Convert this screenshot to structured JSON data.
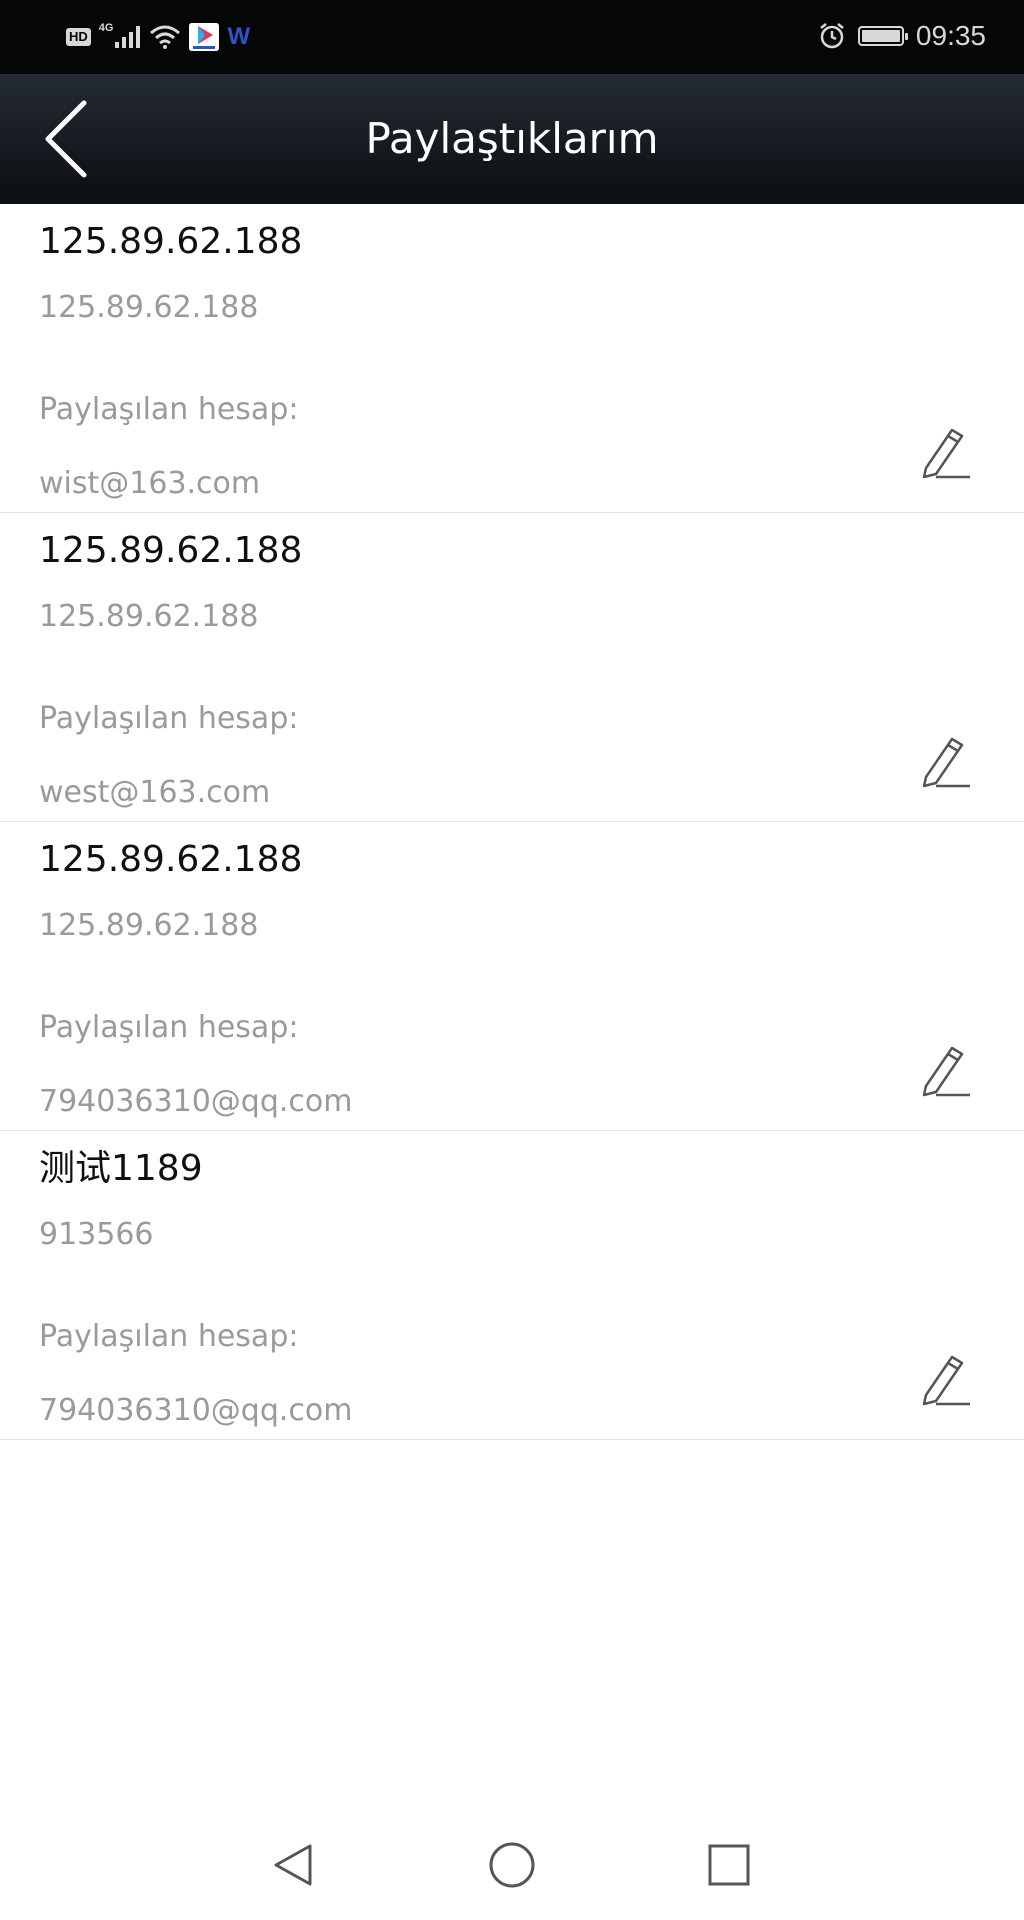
{
  "status_bar": {
    "hd_label": "HD",
    "network_label": "4G",
    "app_badge_letter": "W",
    "time": "09:35",
    "battery_level": 1.0
  },
  "header": {
    "title": "Paylaştıklarım",
    "back_icon": "chevron-left-icon"
  },
  "shares": [
    {
      "name": "125.89.62.188",
      "address": "125.89.62.188",
      "label": "Paylaşılan hesap:",
      "account": "wist@163.com"
    },
    {
      "name": "125.89.62.188",
      "address": "125.89.62.188",
      "label": "Paylaşılan hesap:",
      "account": "west@163.com"
    },
    {
      "name": "125.89.62.188",
      "address": "125.89.62.188",
      "label": "Paylaşılan hesap:",
      "account": "794036310@qq.com"
    },
    {
      "name": "测试1189",
      "address": "913566",
      "label": "Paylaşılan hesap:",
      "account": "794036310@qq.com"
    }
  ],
  "icons": {
    "edit": "pencil-icon",
    "nav_back": "triangle-back-icon",
    "nav_home": "circle-home-icon",
    "nav_recents": "square-recents-icon"
  },
  "colors": {
    "header_bg": "#1a1f25",
    "primary_text": "#101010",
    "secondary_text": "#9a9a9a",
    "divider": "#e2e2e2"
  }
}
